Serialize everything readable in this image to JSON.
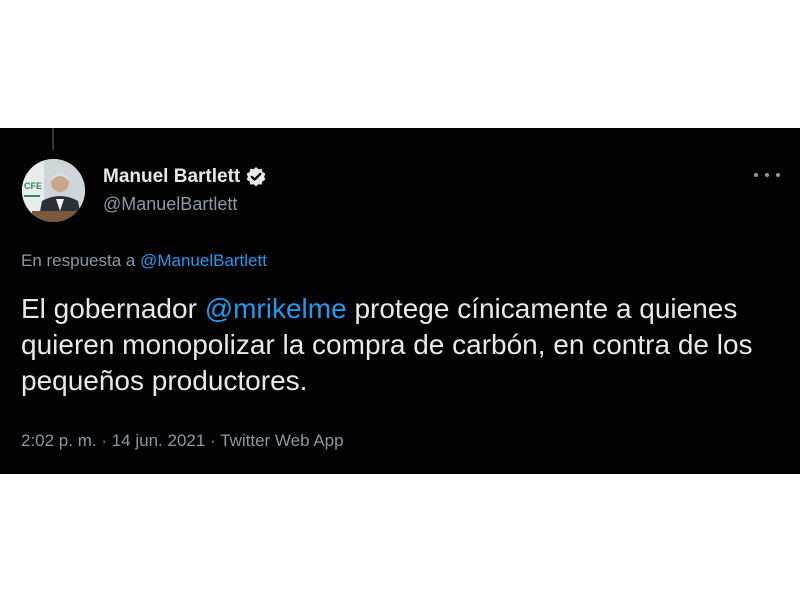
{
  "author": {
    "name": "Manuel Bartlett",
    "handle": "@ManuelBartlett",
    "verified": true,
    "avatar_icon": "user-avatar-photo"
  },
  "reply": {
    "prefix": "En respuesta a",
    "mention": "@ManuelBartlett"
  },
  "tweet": {
    "text_before": "El gobernador ",
    "mention": "@mrikelme",
    "text_after": " protege cínicamente a quienes quieren monopolizar la compra de carbón, en contra de los pequeños productores."
  },
  "meta": {
    "time": "2:02 p. m.",
    "separator": " · ",
    "date": "14 jun. 2021",
    "source": "Twitter Web App"
  },
  "colors": {
    "background": "#000000",
    "text": "#e7e9ea",
    "secondary": "#8b98a5",
    "link": "#1d9bf0"
  }
}
